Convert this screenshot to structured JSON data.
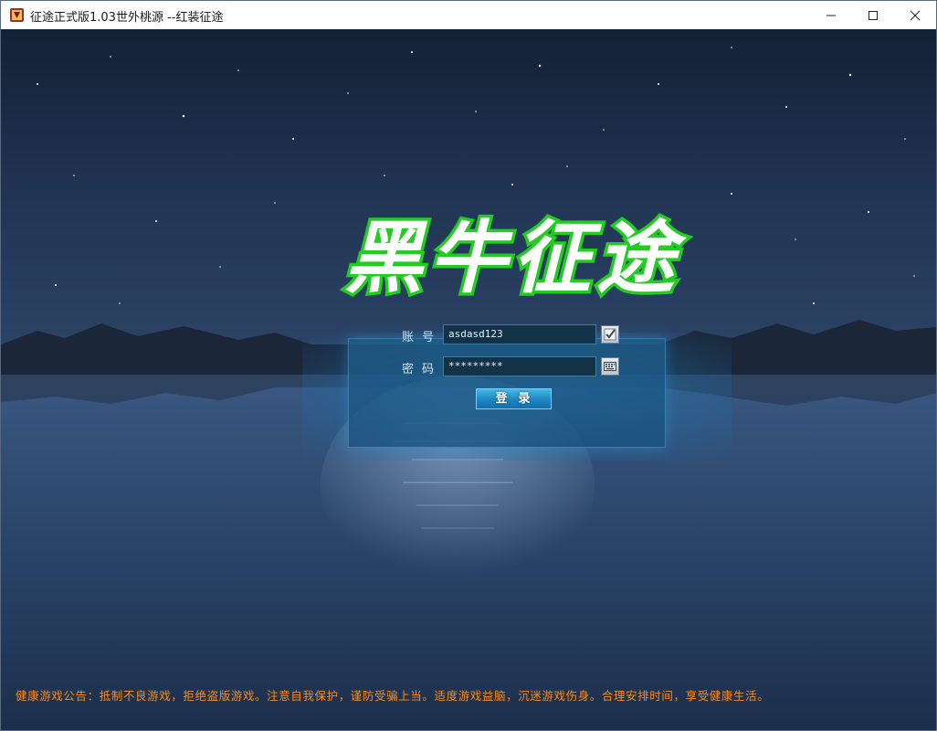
{
  "window": {
    "title": "征途正式版1.03世外桃源 --红装征途",
    "controls": [
      "minimize-icon",
      "maximize-icon",
      "close-icon"
    ]
  },
  "logo": {
    "text": "黑牛征途",
    "fill": "#ffffff",
    "outline": "#22cc22"
  },
  "login": {
    "account_label": "账号",
    "account_value": "asdasd123",
    "password_label": "密码",
    "password_value": "*********",
    "remember_icon": "checkbox-checked-icon",
    "keyboard_icon": "soft-keyboard-icon",
    "login_button": "登录"
  },
  "notice": {
    "text": "健康游戏公告：抵制不良游戏，拒绝盗版游戏。注意自我保护，谨防受骗上当。适度游戏益脑，沉迷游戏伤身。合理安排时间，享受健康生活。",
    "color": "#ff8a14"
  }
}
